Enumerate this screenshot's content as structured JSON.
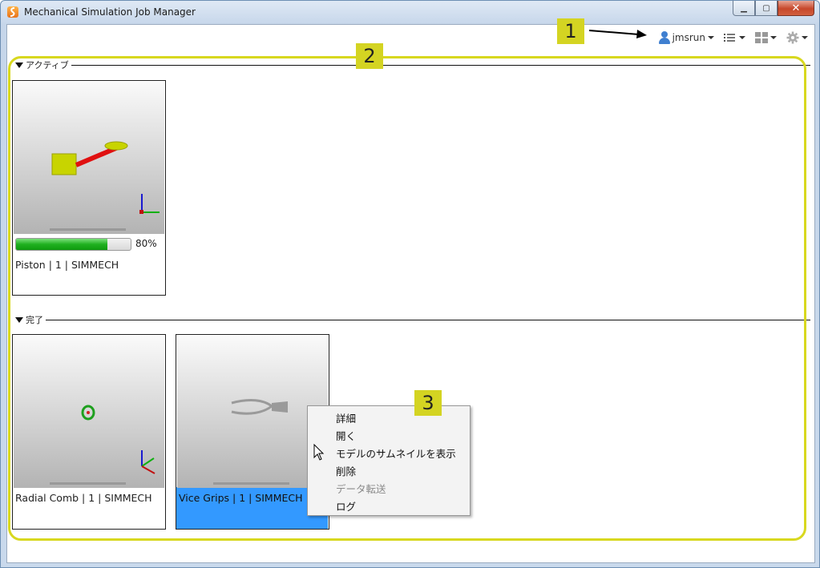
{
  "window": {
    "title": "Mechanical Simulation Job Manager"
  },
  "toolbar": {
    "user": "jmsrun"
  },
  "sections": {
    "active": "アクティブ",
    "done": "完了"
  },
  "jobs": {
    "active": [
      {
        "label": "Piston | 1 | SIMMECH",
        "progress": 0.8,
        "progress_text": "80%"
      }
    ],
    "done": [
      {
        "label": "Radial Comb | 1 | SIMMECH",
        "selected": false
      },
      {
        "label": "Vice Grips | 1 | SIMMECH",
        "selected": true
      }
    ]
  },
  "context_menu": {
    "items": [
      {
        "label": "詳細",
        "enabled": true
      },
      {
        "label": "開く",
        "enabled": true
      },
      {
        "label": "モデルのサムネイルを表示",
        "enabled": true
      },
      {
        "label": "削除",
        "enabled": true
      },
      {
        "label": "データ転送",
        "enabled": false
      },
      {
        "label": "ログ",
        "enabled": true
      }
    ]
  },
  "callouts": [
    "1",
    "2",
    "3"
  ],
  "colors": {
    "progress": "#1fb01f",
    "selection": "#3399ff",
    "callout": "#d4d422"
  }
}
